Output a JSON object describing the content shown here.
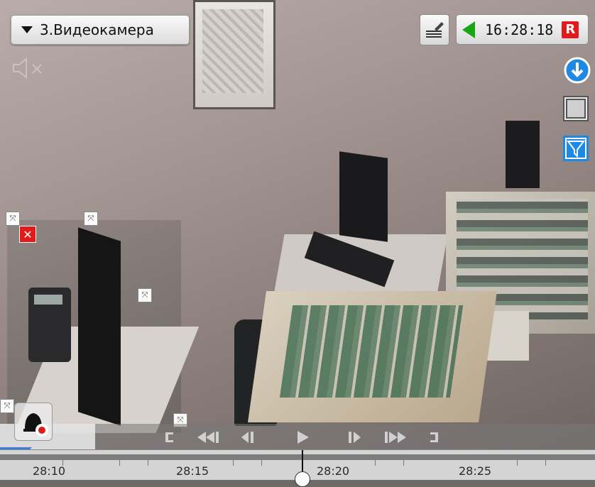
{
  "camera": {
    "label": "3.Видеокамера"
  },
  "status": {
    "time": "16:28:18",
    "rec_badge": "R"
  },
  "colors": {
    "flag": "#17a614",
    "rec": "#e01b1b",
    "accent": "#1e88e5"
  },
  "icons": {
    "camera_menu": "triangle-down-icon",
    "mute": "speaker-muted-icon",
    "notes": "note-edit-icon",
    "live": "green-flag-icon",
    "export": "download-icon",
    "frame": "frame-icon",
    "mask": "mask-icon",
    "alarm": "alarm-bell-icon"
  },
  "playback": {
    "progress_fraction": 0.16
  },
  "timeline": {
    "ticks": [
      "28:10",
      "28:15",
      "28:20",
      "28:25"
    ]
  }
}
